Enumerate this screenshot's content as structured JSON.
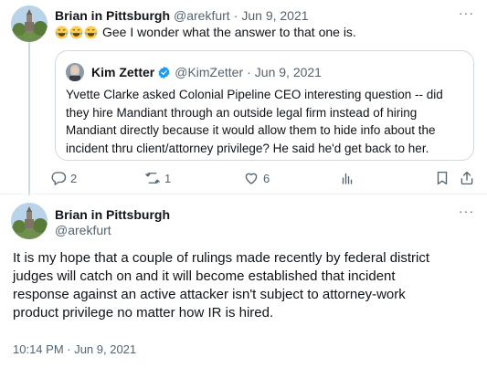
{
  "tweet1": {
    "author_name": "Brian in Pittsburgh",
    "handle": "@arekfurt",
    "sep": "·",
    "date": "Jun 9, 2021",
    "emoji_icons": [
      "joy-emoji",
      "joy-emoji",
      "joy-emoji"
    ],
    "text": "Gee I wonder what the answer to that one is.",
    "more_icon": "···"
  },
  "quote": {
    "author_name": "Kim Zetter",
    "verified_icon": "verified-badge-icon",
    "handle": "@KimZetter",
    "sep": "·",
    "date": "Jun 9, 2021",
    "lines": [
      "Yvette Clarke asked Colonial Pipeline CEO interesting question -- did",
      "they hire Mandiant through an outside legal firm instead of hiring",
      "Mandiant directly because it would allow them to hide info about the",
      "incident thru client/attorney privilege? He said he'd get back to her."
    ]
  },
  "actions": {
    "reply_count": "2",
    "retweet_count": "1",
    "like_count": "6"
  },
  "tweet2": {
    "author_name": "Brian in Pittsburgh",
    "handle": "@arekfurt",
    "more_icon": "···",
    "lines": [
      "It is my hope that a couple of rulings made recently by federal district",
      "judges will catch on and it will become established that incident",
      "response against an active attacker isn't subject to attorney-work",
      "product privilege no matter how IR is hired."
    ],
    "timestamp": "10:14 PM · Jun 9, 2021"
  },
  "colors": {
    "text": "#0f1419",
    "muted": "#536471",
    "border": "#cfd9de",
    "verified": "#1d9bf0"
  }
}
